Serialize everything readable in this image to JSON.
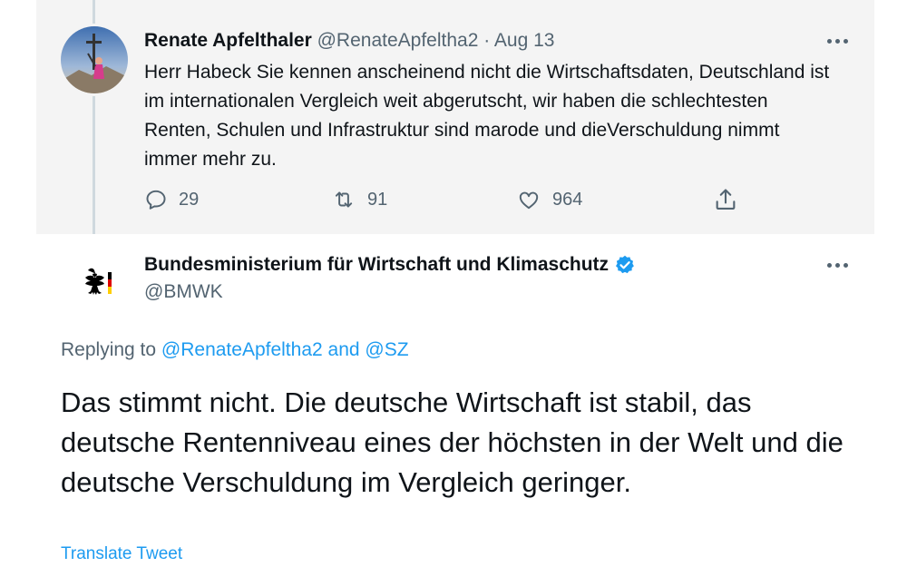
{
  "reply_tweet": {
    "author_name": "Renate Apfelthaler",
    "handle": "@RenateApfeltha2",
    "separator": "·",
    "date": "Aug 13",
    "text": "Herr Habeck Sie kennen anscheinend nicht die Wirtschaftsdaten, Deutschland ist im internationalen Vergleich weit abgerutscht, wir haben die schlechtesten Renten, Schulen und Infrastruktur sind marode und dieVerschuldung nimmt immer mehr zu.",
    "actions": {
      "reply_icon": "speech-bubble-icon",
      "replies": "29",
      "retweet_icon": "retweet-icon",
      "retweets": "91",
      "like_icon": "heart-icon",
      "likes": "964",
      "share_icon": "share-icon"
    }
  },
  "main_tweet": {
    "author_name": "Bundesministerium für Wirtschaft und Klimaschutz",
    "verified": true,
    "handle": "@BMWK",
    "replying_prefix": "Replying to",
    "replying_to_1": "@RenateApfeltha2",
    "replying_and": "and",
    "replying_to_2": "@SZ",
    "text": "Das stimmt nicht. Die deutsche Wirtschaft ist stabil, das deutsche Rentenniveau eines der höchsten in der Welt und die deutsche Verschuldung im Vergleich geringer.",
    "translate_label": "Translate Tweet"
  },
  "colors": {
    "accent": "#1d9bf0",
    "muted_text": "#536471",
    "reply_bg": "#f4f4f4",
    "flag_black": "#000000",
    "flag_red": "#dd0000",
    "flag_gold": "#ffce00"
  }
}
